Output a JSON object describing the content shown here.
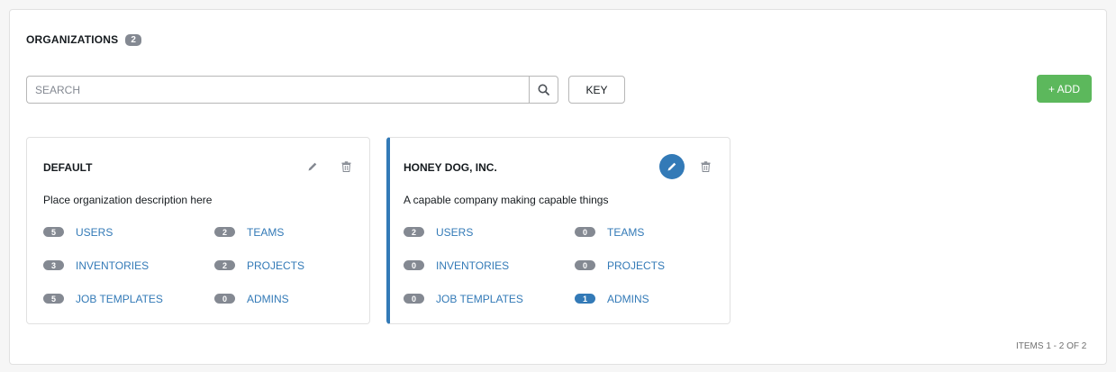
{
  "header": {
    "title": "ORGANIZATIONS",
    "count": "2"
  },
  "search": {
    "placeholder": "SEARCH"
  },
  "toolbar": {
    "key_label": "KEY",
    "add_label": "+ ADD"
  },
  "cards": [
    {
      "name": "DEFAULT",
      "description": "Place organization description here",
      "links": [
        {
          "count": "5",
          "label": "USERS"
        },
        {
          "count": "2",
          "label": "TEAMS"
        },
        {
          "count": "3",
          "label": "INVENTORIES"
        },
        {
          "count": "2",
          "label": "PROJECTS"
        },
        {
          "count": "5",
          "label": "JOB TEMPLATES"
        },
        {
          "count": "0",
          "label": "ADMINS"
        }
      ]
    },
    {
      "name": "HONEY DOG, INC.",
      "description": "A capable company making capable things",
      "links": [
        {
          "count": "2",
          "label": "USERS"
        },
        {
          "count": "0",
          "label": "TEAMS"
        },
        {
          "count": "0",
          "label": "INVENTORIES"
        },
        {
          "count": "0",
          "label": "PROJECTS"
        },
        {
          "count": "0",
          "label": "JOB TEMPLATES"
        },
        {
          "count": "1",
          "label": "ADMINS"
        }
      ]
    }
  ],
  "pagination": {
    "text": "ITEMS  1 - 2 OF 2"
  },
  "colors": {
    "link": "#337ab7",
    "badge": "#848992",
    "add": "#5cb85c",
    "active_border": "#337ab7"
  }
}
